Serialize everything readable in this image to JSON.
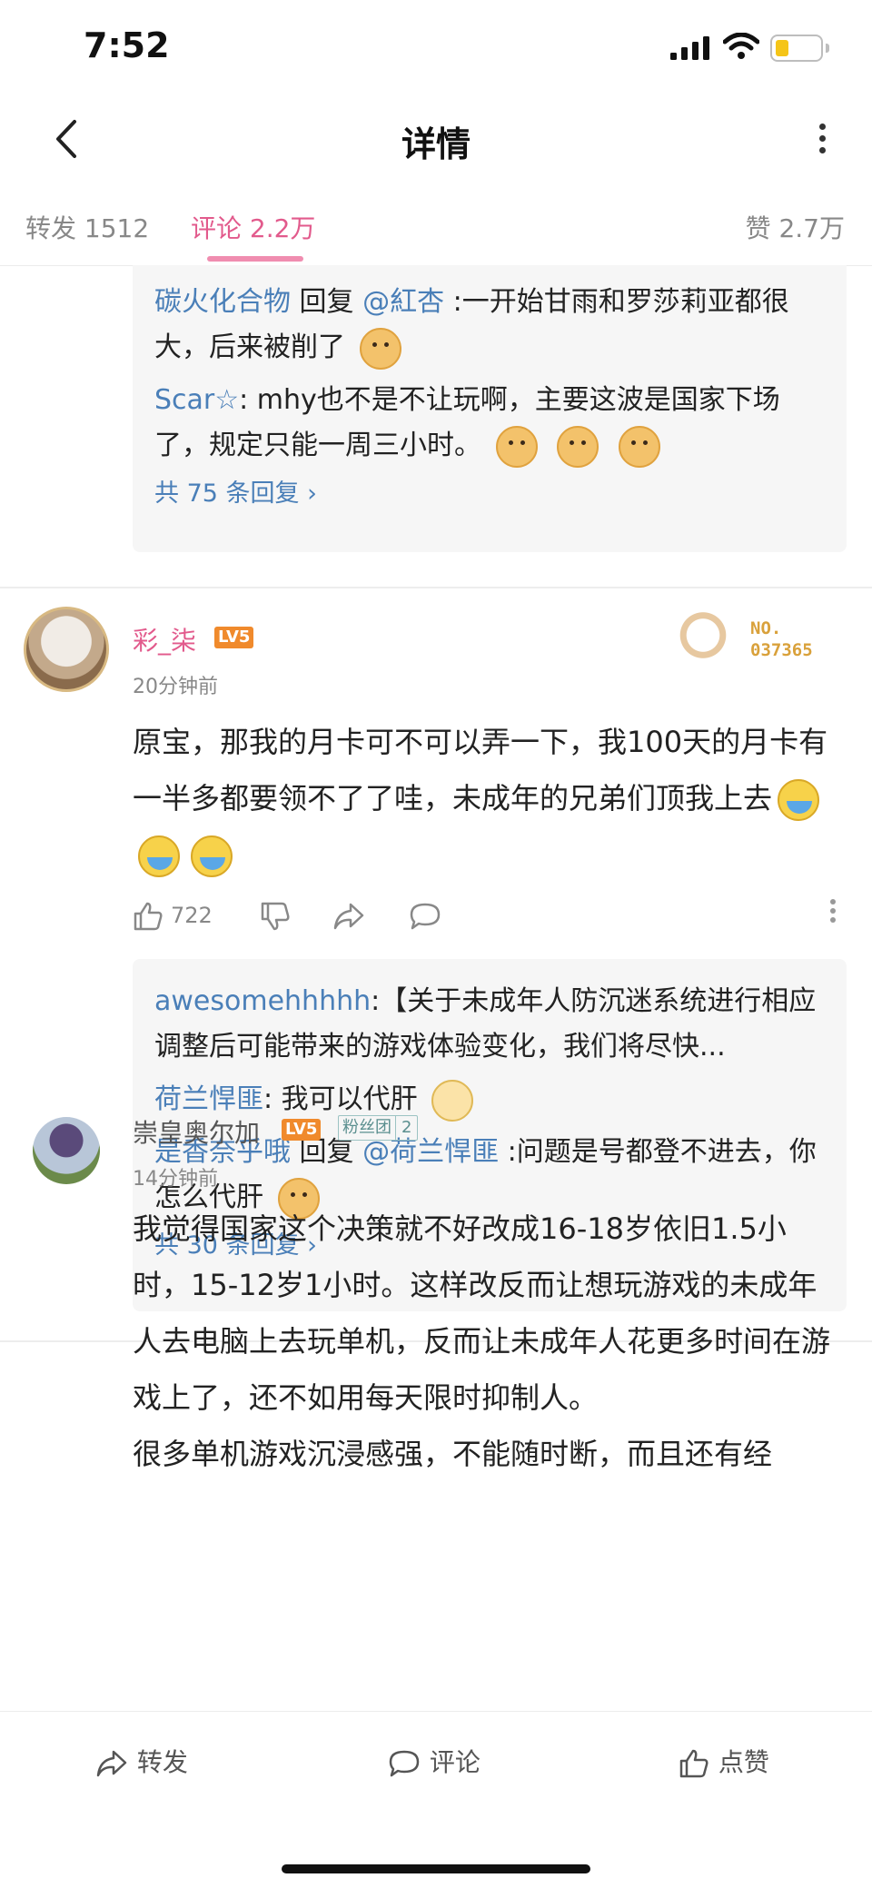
{
  "status": {
    "time": "7:52"
  },
  "nav": {
    "title": "详情"
  },
  "tabs": {
    "repost": "转发 1512",
    "comment": "评论 2.2万",
    "like": "赞 2.7万"
  },
  "thread0": {
    "reply1_user": "碳火化合物",
    "reply1_verb": "回复",
    "reply1_at": "@紅杏",
    "reply1_text": ":一开始甘雨和罗莎莉亚都很大，后来被削了",
    "reply2_user": "Scar☆",
    "reply2_text": ": mhy也不是不让玩啊，主要这波是国家下场了，规定只能一周三小时。",
    "more": "共 75 条回复 ›"
  },
  "comment1": {
    "user": "彩_柒",
    "level": "LV5",
    "badge_no": "NO.",
    "badge_num": "037365",
    "time": "20分钟前",
    "text": "原宝，那我的月卡可不可以弄一下，我100天的月卡有一半多都要领不了了哇，未成年的兄弟们顶我上去",
    "likes": "722",
    "reply1_user": "awesomehhhhh",
    "reply1_text": ":【关于未成年人防沉迷系统进行相应调整后可能带来的游戏体验变化，我们将尽快...",
    "reply2_user": "荷兰悍匪",
    "reply2_text": ": 我可以代肝",
    "reply3_user": "是香奈乎哦",
    "reply3_verb": "回复",
    "reply3_at": "@荷兰悍匪",
    "reply3_text": ":问题是号都登不进去，你怎么代肝",
    "more": "共 30 条回复 ›"
  },
  "comment2": {
    "user": "崇皇奥尔加",
    "level": "LV5",
    "fans_label": "粉丝团",
    "fans_level": "2",
    "time": "14分钟前",
    "text": "我觉得国家这个决策就不好改成16-18岁依旧1.5小时，15-12岁1小时。这样改反而让想玩游戏的未成年人去电脑上去玩单机，反而让未成年人花更多时间在游戏上了，还不如用每天限时抑制人。",
    "text_cut": "很多单机游戏沉浸感强，不能随时断，而且还有经"
  },
  "bottom": {
    "repost": "转发",
    "comment": "评论",
    "like": "点赞"
  }
}
